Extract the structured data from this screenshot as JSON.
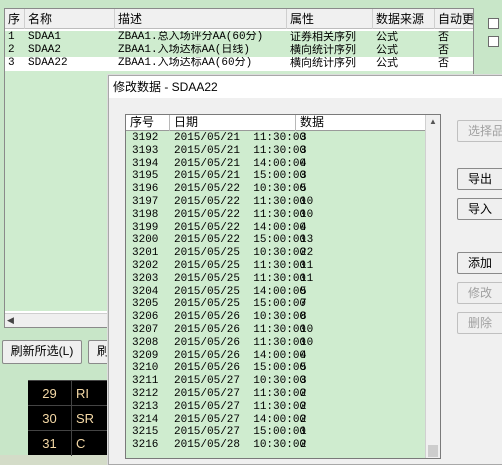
{
  "back": {
    "headers": [
      "序",
      "名称",
      "描述",
      "属性",
      "数据来源",
      "自动更"
    ],
    "rows": [
      {
        "no": "1",
        "name": "SDAA1",
        "desc": "ZBAA1.总入场评分AA(60分)",
        "attr": "证券相关序列",
        "src": "公式",
        "auto": "否"
      },
      {
        "no": "2",
        "name": "SDAA2",
        "desc": "ZBAA1.入场达标AA(日线)",
        "attr": "横向统计序列",
        "src": "公式",
        "auto": "否"
      },
      {
        "no": "3",
        "name": "SDAA22",
        "desc": "ZBAA1.入场达标AA(60分)",
        "attr": "横向统计序列",
        "src": "公式",
        "auto": "否"
      }
    ],
    "refresh_selected": "刷新所选(L)",
    "refresh2": "刷",
    "dark_rows": [
      {
        "num": "29",
        "txt": "RI"
      },
      {
        "num": "30",
        "txt": "SR"
      },
      {
        "num": "31",
        "txt": "C"
      }
    ]
  },
  "dialog": {
    "title": "修改数据 - SDAA22",
    "headers": [
      "序号",
      "日期",
      "数据"
    ],
    "rows": [
      {
        "seq": "3192",
        "date": "2015/05/21  11:30:00",
        "val": "3"
      },
      {
        "seq": "3193",
        "date": "2015/05/21  11:30:00",
        "val": "3"
      },
      {
        "seq": "3194",
        "date": "2015/05/21  14:00:00",
        "val": "4"
      },
      {
        "seq": "3195",
        "date": "2015/05/21  15:00:00",
        "val": "3"
      },
      {
        "seq": "3196",
        "date": "2015/05/22  10:30:00",
        "val": "5"
      },
      {
        "seq": "3197",
        "date": "2015/05/22  11:30:00",
        "val": "10"
      },
      {
        "seq": "3198",
        "date": "2015/05/22  11:30:00",
        "val": "10"
      },
      {
        "seq": "3199",
        "date": "2015/05/22  14:00:00",
        "val": "4"
      },
      {
        "seq": "3200",
        "date": "2015/05/22  15:00:00",
        "val": "13"
      },
      {
        "seq": "3201",
        "date": "2015/05/25  10:30:00",
        "val": "22"
      },
      {
        "seq": "3202",
        "date": "2015/05/25  11:30:00",
        "val": "11"
      },
      {
        "seq": "3203",
        "date": "2015/05/25  11:30:00",
        "val": "11"
      },
      {
        "seq": "3204",
        "date": "2015/05/25  14:00:00",
        "val": "5"
      },
      {
        "seq": "3205",
        "date": "2015/05/25  15:00:00",
        "val": "7"
      },
      {
        "seq": "3206",
        "date": "2015/05/26  10:30:00",
        "val": "8"
      },
      {
        "seq": "3207",
        "date": "2015/05/26  11:30:00",
        "val": "10"
      },
      {
        "seq": "3208",
        "date": "2015/05/26  11:30:00",
        "val": "10"
      },
      {
        "seq": "3209",
        "date": "2015/05/26  14:00:00",
        "val": "4"
      },
      {
        "seq": "3210",
        "date": "2015/05/26  15:00:00",
        "val": "5"
      },
      {
        "seq": "3211",
        "date": "2015/05/27  10:30:00",
        "val": "3"
      },
      {
        "seq": "3212",
        "date": "2015/05/27  11:30:00",
        "val": "2"
      },
      {
        "seq": "3213",
        "date": "2015/05/27  11:30:00",
        "val": "2"
      },
      {
        "seq": "3214",
        "date": "2015/05/27  14:00:00",
        "val": "2"
      },
      {
        "seq": "3215",
        "date": "2015/05/27  15:00:00",
        "val": "1"
      },
      {
        "seq": "3216",
        "date": "2015/05/28  10:30:00",
        "val": "2"
      }
    ],
    "buttons": {
      "select": "选择品",
      "export": "导出",
      "import": "导入",
      "add": "添加",
      "modify": "修改",
      "delete": "删除"
    }
  }
}
